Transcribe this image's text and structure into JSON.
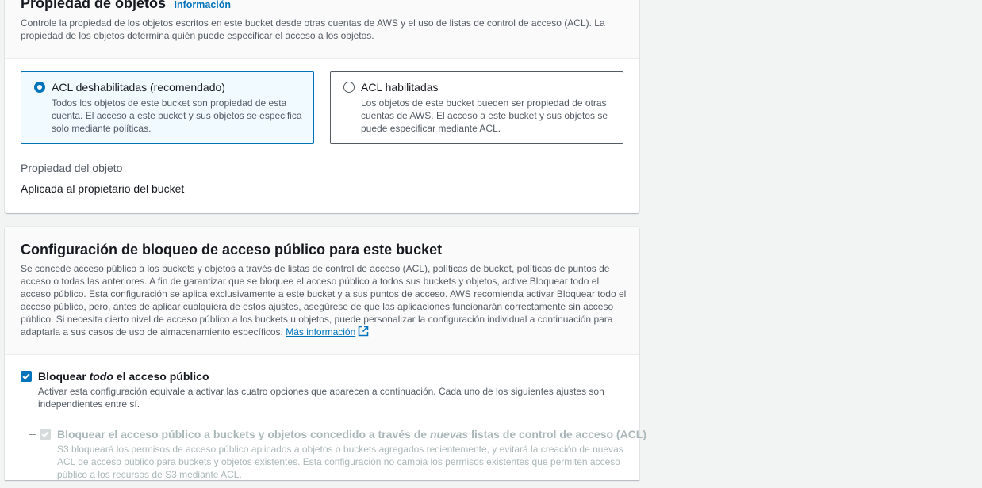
{
  "object_ownership": {
    "title": "Propiedad de objetos",
    "info_link": "Información",
    "description": "Controle la propiedad de los objetos escritos en este bucket desde otras cuentas de AWS y el uso de listas de control de acceso (ACL). La propiedad de los objetos determina quién puede especificar el acceso a los objetos.",
    "options": [
      {
        "label": "ACL deshabilitadas (recomendado)",
        "description": "Todos los objetos de este bucket son propiedad de esta cuenta. El acceso a este bucket y sus objetos se especifica solo mediante políticas.",
        "selected": true
      },
      {
        "label": "ACL habilitadas",
        "description": "Los objetos de este bucket pueden ser propiedad de otras cuentas de AWS. El acceso a este bucket y sus objetos se puede especificar mediante ACL.",
        "selected": false
      }
    ],
    "property_label": "Propiedad del objeto",
    "property_value": "Aplicada al propietario del bucket"
  },
  "block_public_access": {
    "title": "Configuración de bloqueo de acceso público para este bucket",
    "description": "Se concede acceso público a los buckets y objetos a través de listas de control de acceso (ACL), políticas de bucket, políticas de puntos de acceso o todas las anteriores. A fin de garantizar que se bloquee el acceso público a todos sus buckets y objetos, active Bloquear todo el acceso público. Esta configuración se aplica exclusivamente a este bucket y a sus puntos de acceso. AWS recomienda activar Bloquear todo el acceso público, pero, antes de aplicar cualquiera de estos ajustes, asegúrese de que las aplicaciones funcionarán correctamente sin acceso público. Si necesita cierto nivel de acceso público a los buckets u objetos, puede personalizar la configuración individual a continuación para adaptarla a sus casos de uso de almacenamiento específicos.",
    "learn_more_link": "Más información",
    "block_all": {
      "label_prefix": "Bloquear ",
      "label_emphasis": "todo",
      "label_suffix": " el acceso público",
      "description": "Activar esta configuración equivale a activar las cuatro opciones que aparecen a continuación. Cada uno de los siguientes ajustes son independientes entre sí.",
      "checked": true
    },
    "sub_options": [
      {
        "label_prefix": "Bloquear el acceso público a buckets y objetos concedido a través de ",
        "label_emphasis": "nuevas",
        "label_suffix": " listas de control de acceso (ACL)",
        "description": "S3 bloqueará los permisos de acceso público aplicados a objetos o buckets agregados recientemente, y evitará la creación de nuevas ACL de acceso público para buckets y objetos existentes. Esta configuración no cambia los permisos existentes que permiten acceso público a los recursos de S3 mediante ACL.",
        "checked": true,
        "disabled": true
      }
    ]
  },
  "colors": {
    "accent": "#0073bb",
    "selected_tile_bg": "#f1faff",
    "page_bg": "#f2f3f3",
    "disabled_text": "#aab7b8"
  }
}
